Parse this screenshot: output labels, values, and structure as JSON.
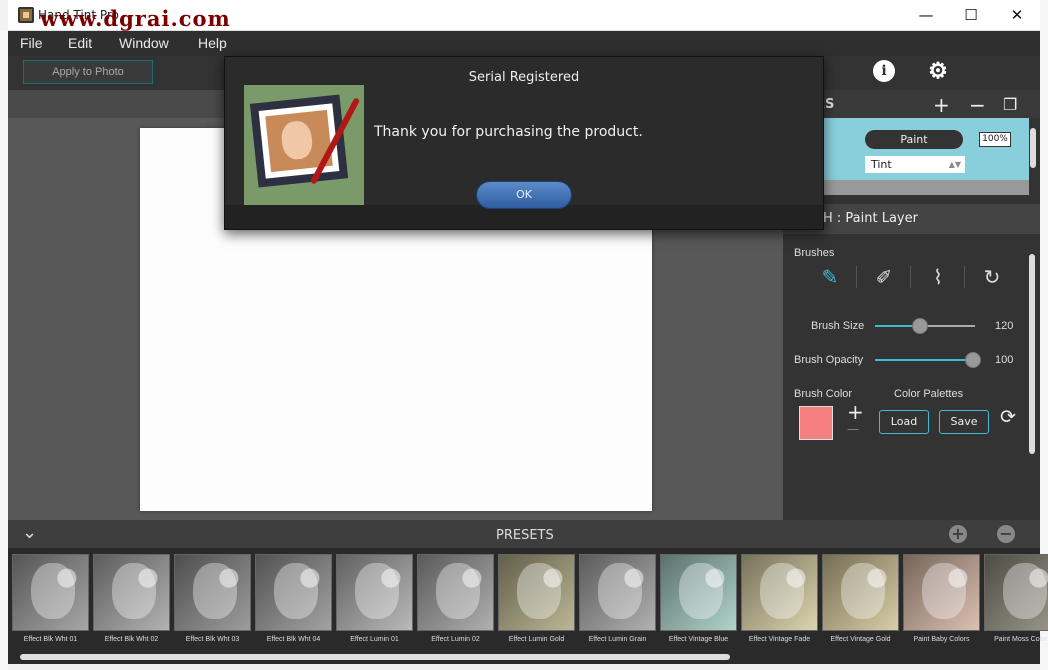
{
  "window": {
    "title": "Hand Tint Pro",
    "watermark": "www.dgrai.com",
    "minimize_glyph": "—",
    "maximize_glyph": "☐",
    "close_glyph": "✕"
  },
  "menu": {
    "items": [
      "File",
      "Edit",
      "Window",
      "Help"
    ]
  },
  "toolbar": {
    "apply_label": "Apply to Photo",
    "info_icon": "info-icon",
    "settings_icon": "settings-icon"
  },
  "layers": {
    "title": "RS",
    "add_glyph": "+",
    "remove_glyph": "−",
    "duplicate_glyph": "❐",
    "layer_name": "Paint",
    "layer_opacity": "100%",
    "blend_mode": "Tint"
  },
  "paint_panel": {
    "title": "H : Paint Layer",
    "brushes_label": "Brushes",
    "brush_size_label": "Brush Size",
    "brush_size_value": "120",
    "brush_size_fraction": 0.45,
    "brush_opacity_label": "Brush Opacity",
    "brush_opacity_value": "100",
    "brush_opacity_fraction": 0.98,
    "brush_color_label": "Brush Color",
    "color_palettes_label": "Color Palettes",
    "brush_color": "#f58080",
    "accent": "#3dbcd4",
    "load_label": "Load",
    "save_label": "Save",
    "plus_glyph": "+",
    "minus_glyph": "—",
    "tool_glyphs": [
      "✎",
      "✐",
      "⌇",
      "↻"
    ],
    "reset_glyph": "⟳"
  },
  "presets": {
    "title": "PRESETS",
    "collapse_glyph": "⌄",
    "add_glyph": "+",
    "remove_glyph": "−",
    "items": [
      {
        "label": "Effect Blk Wht 01",
        "tone": "#9a9a9a"
      },
      {
        "label": "Effect Blk Wht 02",
        "tone": "#a8a8a8"
      },
      {
        "label": "Effect Blk Wht 03",
        "tone": "#8e8e8e"
      },
      {
        "label": "Effect Blk Wht 04",
        "tone": "#959595"
      },
      {
        "label": "Effect Lumin 01",
        "tone": "#b0b0b0"
      },
      {
        "label": "Effect Lumin 02",
        "tone": "#a4a4a4"
      },
      {
        "label": "Effect Lumin Gold",
        "tone": "#b3ad86"
      },
      {
        "label": "Effect Lumin Grain",
        "tone": "#a6a6a6"
      },
      {
        "label": "Effect Vintage Blue",
        "tone": "#a6cfc4"
      },
      {
        "label": "Effect Vintage Fade",
        "tone": "#d8d0a4"
      },
      {
        "label": "Effect Vintage Gold",
        "tone": "#d6c89a"
      },
      {
        "label": "Paint Baby Colors",
        "tone": "#d8b8a6"
      },
      {
        "label": "Paint Moss Colors",
        "tone": "#8e8a7c"
      }
    ]
  },
  "dialog": {
    "title": "Serial Registered",
    "message": "Thank you for purchasing the product.",
    "ok_label": "OK"
  }
}
